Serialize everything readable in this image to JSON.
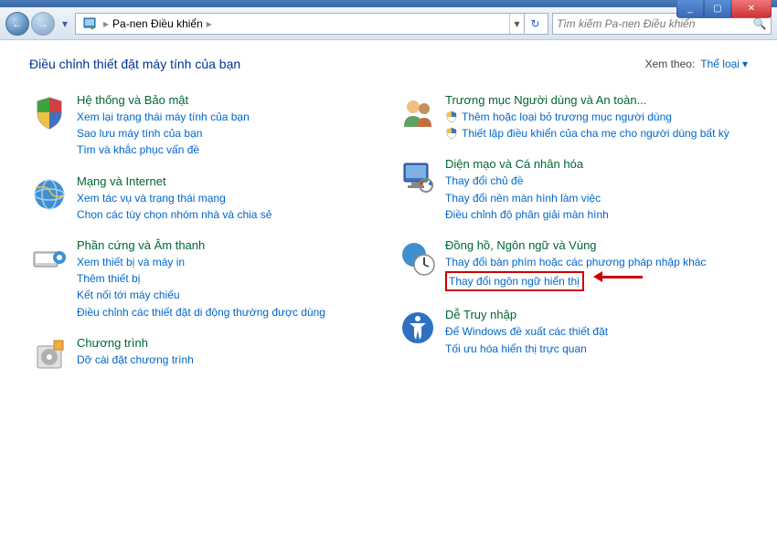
{
  "titlebar": {
    "min_label": "_",
    "max_label": "▢",
    "close_label": "✕"
  },
  "nav": {
    "back_glyph": "←",
    "forward_glyph": "→",
    "dropdown_glyph": "▾"
  },
  "address": {
    "sep": "▸",
    "item": "Pa-nen Điều khiển",
    "drop_glyph": "▾",
    "refresh_glyph": "↻"
  },
  "search": {
    "placeholder": "Tìm kiếm Pa-nen Điều khiển",
    "icon": "🔍"
  },
  "header": {
    "title": "Điều chỉnh thiết đặt máy tính của bạn",
    "viewby_label": "Xem theo:",
    "viewby_value": "Thể loại",
    "viewby_arrow": "▾"
  },
  "categories": {
    "left": [
      {
        "id": "system-security",
        "title": "Hệ thống và Bảo mật",
        "links": [
          {
            "text": "Xem lại trạng thái máy tính của bạn"
          },
          {
            "text": "Sao lưu máy tính của bạn"
          },
          {
            "text": "Tìm và khắc phục vấn đề"
          }
        ]
      },
      {
        "id": "network-internet",
        "title": "Mạng và Internet",
        "links": [
          {
            "text": "Xem tác vụ và trạng thái mạng"
          },
          {
            "text": "Chọn các tùy chọn nhóm nhà và chia sẻ"
          }
        ]
      },
      {
        "id": "hardware-sound",
        "title": "Phần cứng và Âm thanh",
        "links": [
          {
            "text": "Xem thiết bị và máy in"
          },
          {
            "text": "Thêm thiết bị"
          },
          {
            "text": "Kết nối tới máy chiếu"
          },
          {
            "text": "Điều chỉnh các thiết đặt di động thường được dùng"
          }
        ]
      },
      {
        "id": "programs",
        "title": "Chương trình",
        "links": [
          {
            "text": "Dỡ cài đặt chương trình"
          }
        ]
      }
    ],
    "right": [
      {
        "id": "user-accounts",
        "title": "Trương mục Người dùng và An toàn...",
        "links": [
          {
            "text": "Thêm hoặc loại bỏ trương mục người dùng",
            "shield": true
          },
          {
            "text": "Thiết lập điều khiển của cha mẹ cho người dùng bất kỳ",
            "shield": true
          }
        ]
      },
      {
        "id": "appearance",
        "title": "Diện mạo và Cá nhân hóa",
        "links": [
          {
            "text": "Thay đổi chủ đề"
          },
          {
            "text": "Thay đổi nền màn hình làm việc"
          },
          {
            "text": "Điều chỉnh độ phân giải màn hình"
          }
        ]
      },
      {
        "id": "clock-language",
        "title": "Đồng hồ, Ngôn ngữ và Vùng",
        "links": [
          {
            "text": "Thay đổi bàn phím hoặc các phương pháp nhập khác"
          },
          {
            "text": "Thay đổi ngôn ngữ hiển thị",
            "highlight": true
          }
        ]
      },
      {
        "id": "ease-of-access",
        "title": "Dễ Truy nhập",
        "links": [
          {
            "text": "Để Windows đề xuất các thiết đặt"
          },
          {
            "text": "Tối ưu hóa hiển thị trực quan"
          }
        ]
      }
    ]
  }
}
